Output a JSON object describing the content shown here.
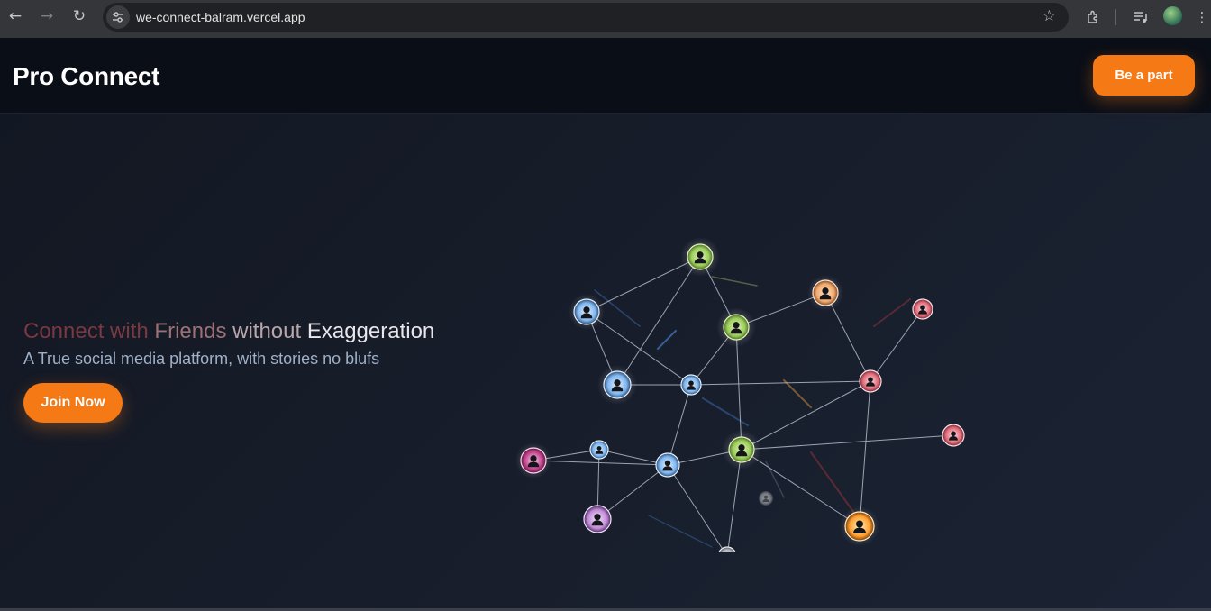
{
  "browser": {
    "url": "we-connect-balram.vercel.app",
    "icons": [
      "back-arrow-icon",
      "forward-arrow-icon",
      "reload-icon",
      "site-info-icon",
      "bookmark-star-icon",
      "extensions-icon",
      "media-queue-icon",
      "profile-avatar",
      "menu-kebab-icon"
    ]
  },
  "header": {
    "brand": "Pro Connect",
    "cta_label": "Be a part"
  },
  "hero": {
    "title_parts": [
      "Connect with",
      "Friends",
      "without",
      "Exaggeration"
    ],
    "subtitle": "A True social media platform, with stories no blufs",
    "cta_label": "Join Now"
  },
  "illustration": {
    "name": "social-network-graph",
    "node_count": 17,
    "accent_colors": [
      "#9acd5a",
      "#f2a86b",
      "#e06a78",
      "#7fb6ef",
      "#c06ad6",
      "#ff9f2e"
    ]
  },
  "colors": {
    "accent": "#f57a16",
    "header_bg": "#0a0e17",
    "page_bg": "#171d2a"
  }
}
